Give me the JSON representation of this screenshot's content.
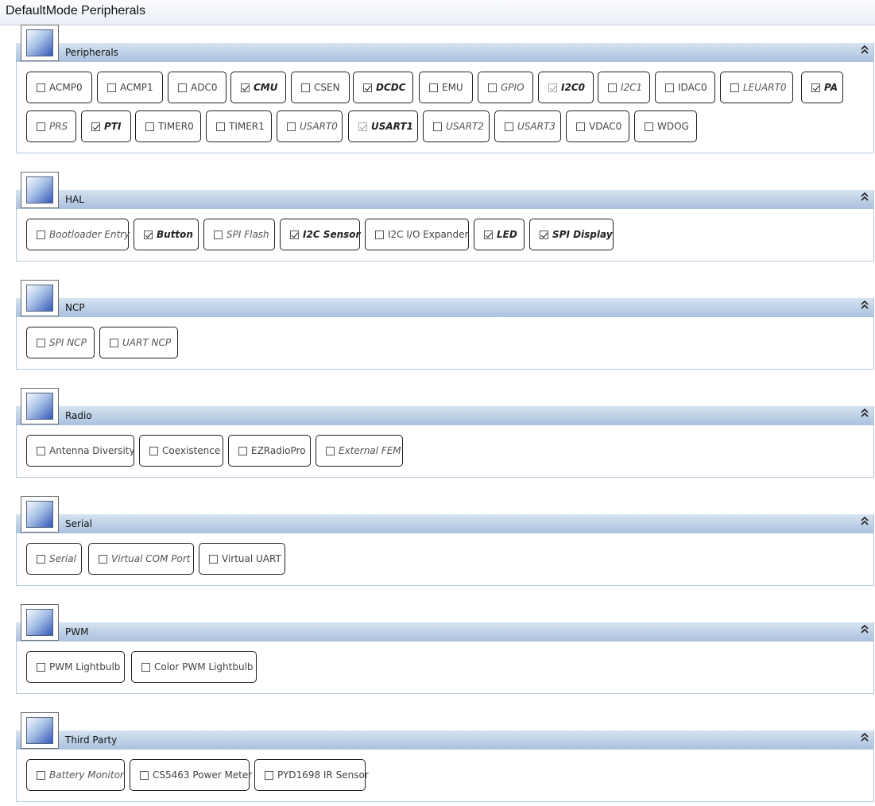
{
  "window": {
    "title": "DefaultMode Peripherals"
  },
  "sections": [
    {
      "label": "Peripherals",
      "items": [
        {
          "label": "ACMP0",
          "checked": false,
          "style": "normal"
        },
        {
          "label": "ACMP1",
          "checked": false,
          "style": "normal"
        },
        {
          "label": "ADC0",
          "checked": false,
          "style": "normal"
        },
        {
          "label": "CMU",
          "checked": true,
          "style": "bold"
        },
        {
          "label": "CSEN",
          "checked": false,
          "style": "normal"
        },
        {
          "label": "DCDC",
          "checked": true,
          "style": "bold"
        },
        {
          "label": "EMU",
          "checked": false,
          "style": "normal"
        },
        {
          "label": "GPIO",
          "checked": false,
          "style": "italic"
        },
        {
          "label": "I2C0",
          "checked": true,
          "style": "bold",
          "disabled": true
        },
        {
          "label": "I2C1",
          "checked": false,
          "style": "italic"
        },
        {
          "label": "IDAC0",
          "checked": false,
          "style": "normal"
        },
        {
          "label": "LEUART0",
          "checked": false,
          "style": "italic"
        },
        {
          "label": "PA",
          "checked": true,
          "style": "bold"
        },
        {
          "label": "PRS",
          "checked": false,
          "style": "italic"
        },
        {
          "label": "PTI",
          "checked": true,
          "style": "bold"
        },
        {
          "label": "TIMER0",
          "checked": false,
          "style": "normal"
        },
        {
          "label": "TIMER1",
          "checked": false,
          "style": "normal"
        },
        {
          "label": "USART0",
          "checked": false,
          "style": "italic"
        },
        {
          "label": "USART1",
          "checked": true,
          "style": "bold",
          "disabled": true
        },
        {
          "label": "USART2",
          "checked": false,
          "style": "italic"
        },
        {
          "label": "USART3",
          "checked": false,
          "style": "italic"
        },
        {
          "label": "VDAC0",
          "checked": false,
          "style": "normal"
        },
        {
          "label": "WDOG",
          "checked": false,
          "style": "normal"
        }
      ]
    },
    {
      "label": "HAL",
      "items": [
        {
          "label": "Bootloader Entry",
          "checked": false,
          "style": "italic"
        },
        {
          "label": "Button",
          "checked": true,
          "style": "bold"
        },
        {
          "label": "SPI Flash",
          "checked": false,
          "style": "italic"
        },
        {
          "label": "I2C Sensor",
          "checked": true,
          "style": "bold"
        },
        {
          "label": "I2C I/O Expander",
          "checked": false,
          "style": "normal"
        },
        {
          "label": "LED",
          "checked": true,
          "style": "bold"
        },
        {
          "label": "SPI Display",
          "checked": true,
          "style": "bold"
        }
      ]
    },
    {
      "label": "NCP",
      "items": [
        {
          "label": "SPI NCP",
          "checked": false,
          "style": "italic"
        },
        {
          "label": "UART NCP",
          "checked": false,
          "style": "italic"
        }
      ]
    },
    {
      "label": "Radio",
      "items": [
        {
          "label": "Antenna Diversity",
          "checked": false,
          "style": "normal"
        },
        {
          "label": "Coexistence",
          "checked": false,
          "style": "normal"
        },
        {
          "label": "EZRadioPro",
          "checked": false,
          "style": "normal"
        },
        {
          "label": "External FEM",
          "checked": false,
          "style": "italic"
        }
      ]
    },
    {
      "label": "Serial",
      "items": [
        {
          "label": "Serial",
          "checked": false,
          "style": "italic"
        },
        {
          "label": "Virtual COM Port",
          "checked": false,
          "style": "italic"
        },
        {
          "label": "Virtual UART",
          "checked": false,
          "style": "normal"
        }
      ]
    },
    {
      "label": "PWM",
      "items": [
        {
          "label": "PWM Lightbulb",
          "checked": false,
          "style": "normal"
        },
        {
          "label": "Color PWM Lightbulb",
          "checked": false,
          "style": "normal"
        }
      ]
    },
    {
      "label": "Third Party",
      "items": [
        {
          "label": "Battery Monitor",
          "checked": false,
          "style": "italic"
        },
        {
          "label": "CS5463 Power Meter",
          "checked": false,
          "style": "normal"
        },
        {
          "label": "PYD1698 IR Sensor",
          "checked": false,
          "style": "normal"
        }
      ]
    }
  ],
  "icons": {
    "collapse": "chevron-double-up-icon",
    "section": "section-image-icon"
  }
}
